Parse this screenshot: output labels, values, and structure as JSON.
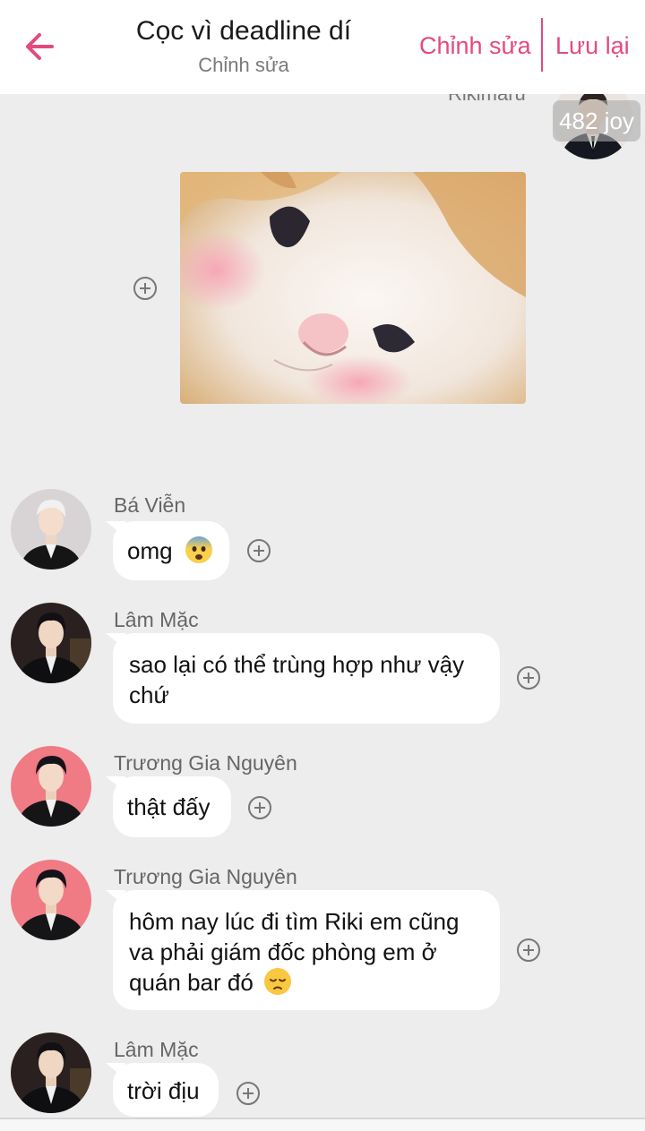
{
  "header": {
    "title": "Cọc vì deadline dí",
    "subtitle": "Chỉnh sửa",
    "edit_label": "Chỉnh sửa",
    "save_label": "Lưu lại",
    "accent_color": "#e4497f"
  },
  "top_message": {
    "sender": "Rikimaru",
    "joy_badge": "482 joy",
    "sticker_icon": "cat-sticker"
  },
  "messages": [
    {
      "sender": "Bá Viễn",
      "text": "omg",
      "emoji": "anxious-face-emoji"
    },
    {
      "sender": "Lâm Mặc",
      "text": "sao lại có thể trùng hợp như vậy chứ"
    },
    {
      "sender": "Trương Gia Nguyên",
      "text": "thật đấy"
    },
    {
      "sender": "Trương Gia Nguyên",
      "text": "hôm nay lúc đi tìm Riki em cũng va phải giám đốc phòng em ở quán bar đó",
      "emoji": "pensive-face-emoji"
    },
    {
      "sender": "Lâm Mặc",
      "text": "trời địu"
    }
  ]
}
